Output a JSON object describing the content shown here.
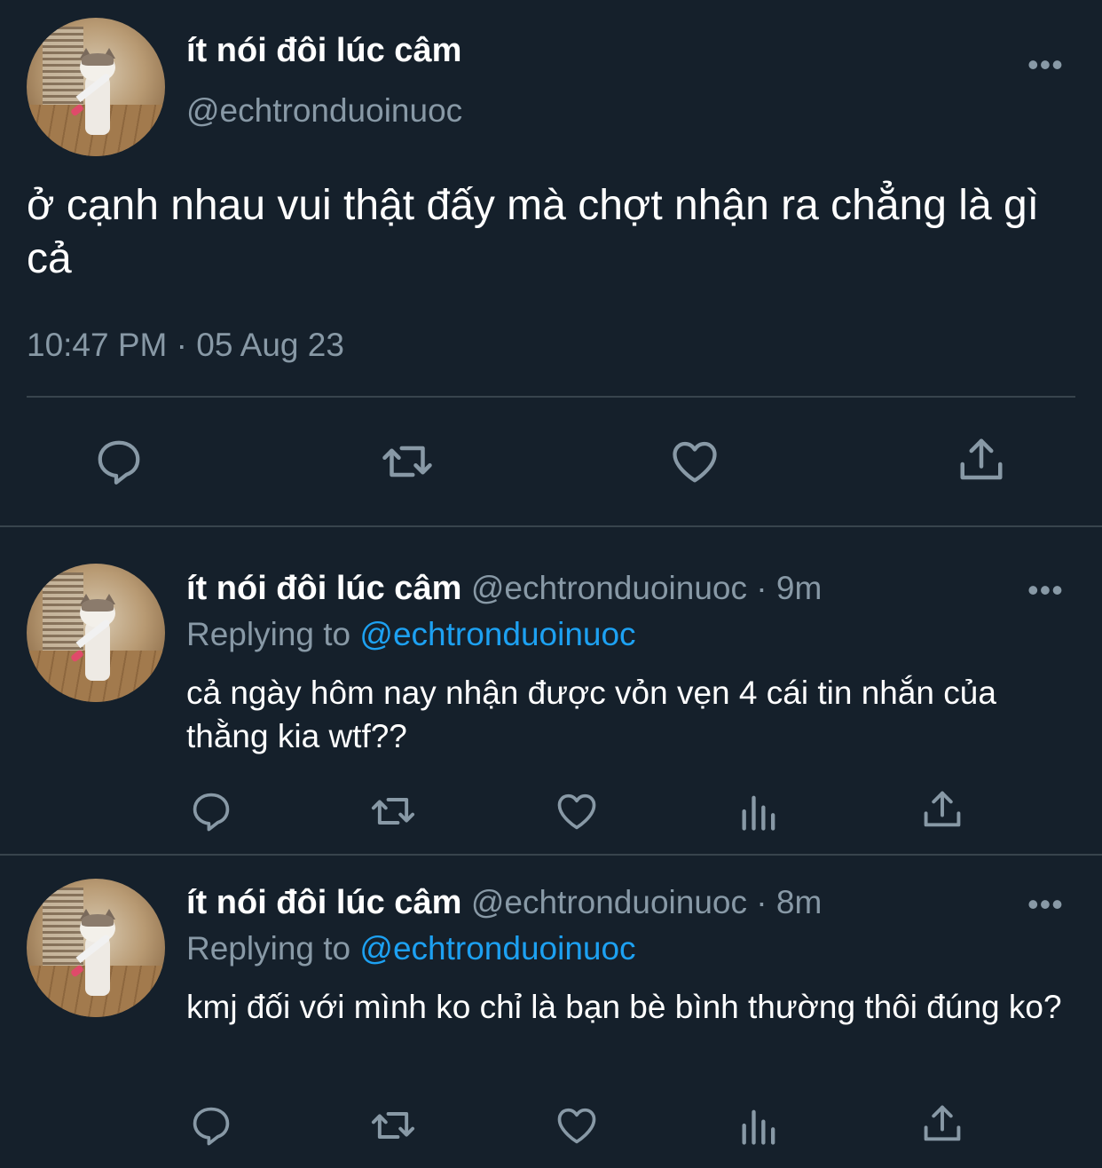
{
  "main_tweet": {
    "display_name": "ít nói đôi lúc câm",
    "handle": "@echtronduoinuoc",
    "more_label": "•••",
    "text": "ở cạnh nhau vui thật đấy mà chợt nhận ra chẳng là gì cả",
    "timestamp": "10:47 PM · 05 Aug 23",
    "actions": [
      "reply-icon",
      "retweet-icon",
      "like-icon",
      "share-icon"
    ]
  },
  "replies": [
    {
      "display_name": "ít nói đôi lúc câm",
      "handle_time": "@echtronduoinuoc · 9m",
      "replying_label": "Replying to ",
      "replying_mention": "@echtronduoinuoc",
      "more_label": "•••",
      "text": "cả ngày hôm nay nhận được vỏn vẹn 4 cái tin nhắn của thằng kia wtf??",
      "actions": [
        "reply-icon",
        "retweet-icon",
        "like-icon",
        "analytics-icon",
        "share-icon"
      ]
    },
    {
      "display_name": "ít nói đôi lúc câm",
      "handle_time": "@echtronduoinuoc · 8m",
      "replying_label": "Replying to ",
      "replying_mention": "@echtronduoinuoc",
      "more_label": "•••",
      "text": "kmj đối với mình ko chỉ là bạn bè bình thường thôi đúng ko?",
      "actions": [
        "reply-icon",
        "retweet-icon",
        "like-icon",
        "analytics-icon",
        "share-icon"
      ]
    }
  ],
  "colors": {
    "background": "#15202b",
    "secondary_text": "#8899a6",
    "mention": "#1da1f2",
    "divider": "#38444d"
  }
}
